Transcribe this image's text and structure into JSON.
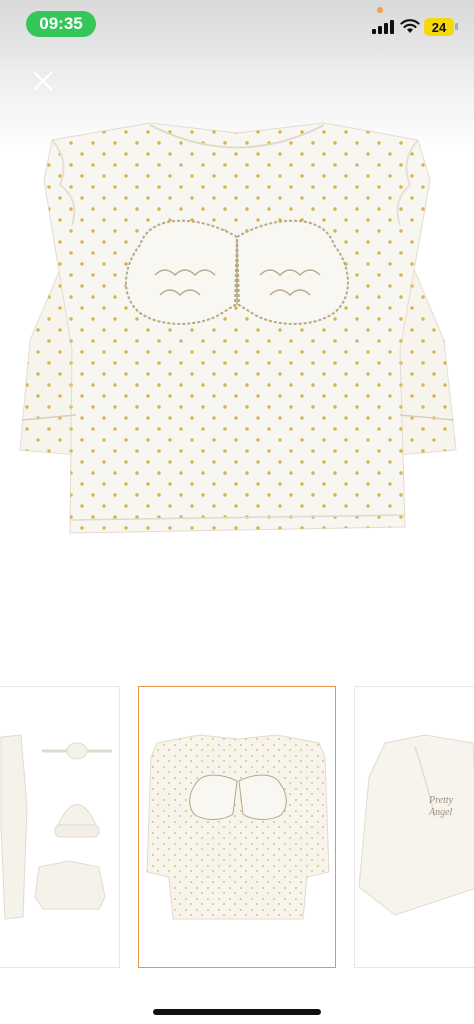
{
  "status_bar": {
    "time": "09:35",
    "battery_level": "24",
    "signal_icon": "cellular-signal-icon",
    "wifi_icon": "wifi-icon"
  },
  "toolbar": {
    "close_icon": "close-icon"
  },
  "product_gallery": {
    "main_image": "baby-top-with-angel-wings",
    "thumbnails": [
      {
        "name": "outfit-set",
        "selected": false
      },
      {
        "name": "angel-wing-top",
        "selected": true
      },
      {
        "name": "pretty-angel-top",
        "selected": false,
        "printed_text": "Pretty Angel"
      }
    ]
  },
  "colors": {
    "time_pill": "#33c759",
    "battery": "#f5d90a",
    "selection_border": "#e8954a",
    "polka_dot": "#d9b24a",
    "fabric": "#f7f4ed"
  }
}
